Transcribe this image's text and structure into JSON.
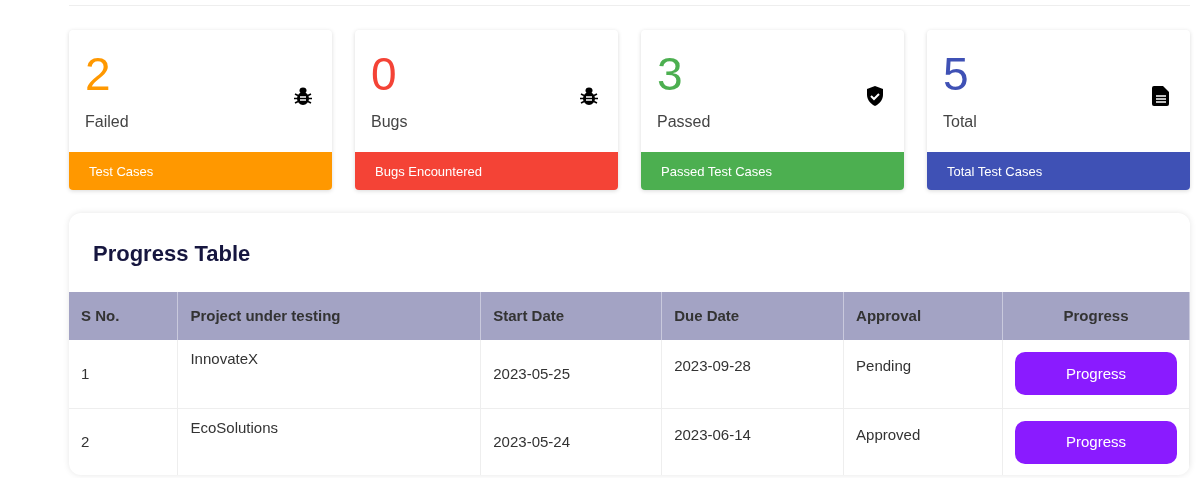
{
  "stat_cards": [
    {
      "value": "2",
      "label": "Failed",
      "footer": "Test Cases",
      "kind": "bug",
      "color": "#ff9800"
    },
    {
      "value": "0",
      "label": "Bugs",
      "footer": "Bugs Encountered",
      "kind": "bug",
      "color": "#f44336"
    },
    {
      "value": "3",
      "label": "Passed",
      "footer": "Passed Test Cases",
      "kind": "shield",
      "color": "#4caf50"
    },
    {
      "value": "5",
      "label": "Total",
      "footer": "Total Test Cases",
      "kind": "file",
      "color": "#3f51b5"
    }
  ],
  "progress_table": {
    "title": "Progress Table",
    "columns": [
      "S No.",
      "Project under testing",
      "Start Date",
      "Due Date",
      "Approval",
      "Progress"
    ],
    "rows": [
      {
        "s_no": "1",
        "project": "InnovateX",
        "start_date": "2023-05-25",
        "due_date": "2023-09-28",
        "approval": "Pending",
        "action": "Progress"
      },
      {
        "s_no": "2",
        "project": "EcoSolutions",
        "start_date": "2023-05-24",
        "due_date": "2023-06-14",
        "approval": "Approved",
        "action": "Progress"
      }
    ]
  }
}
